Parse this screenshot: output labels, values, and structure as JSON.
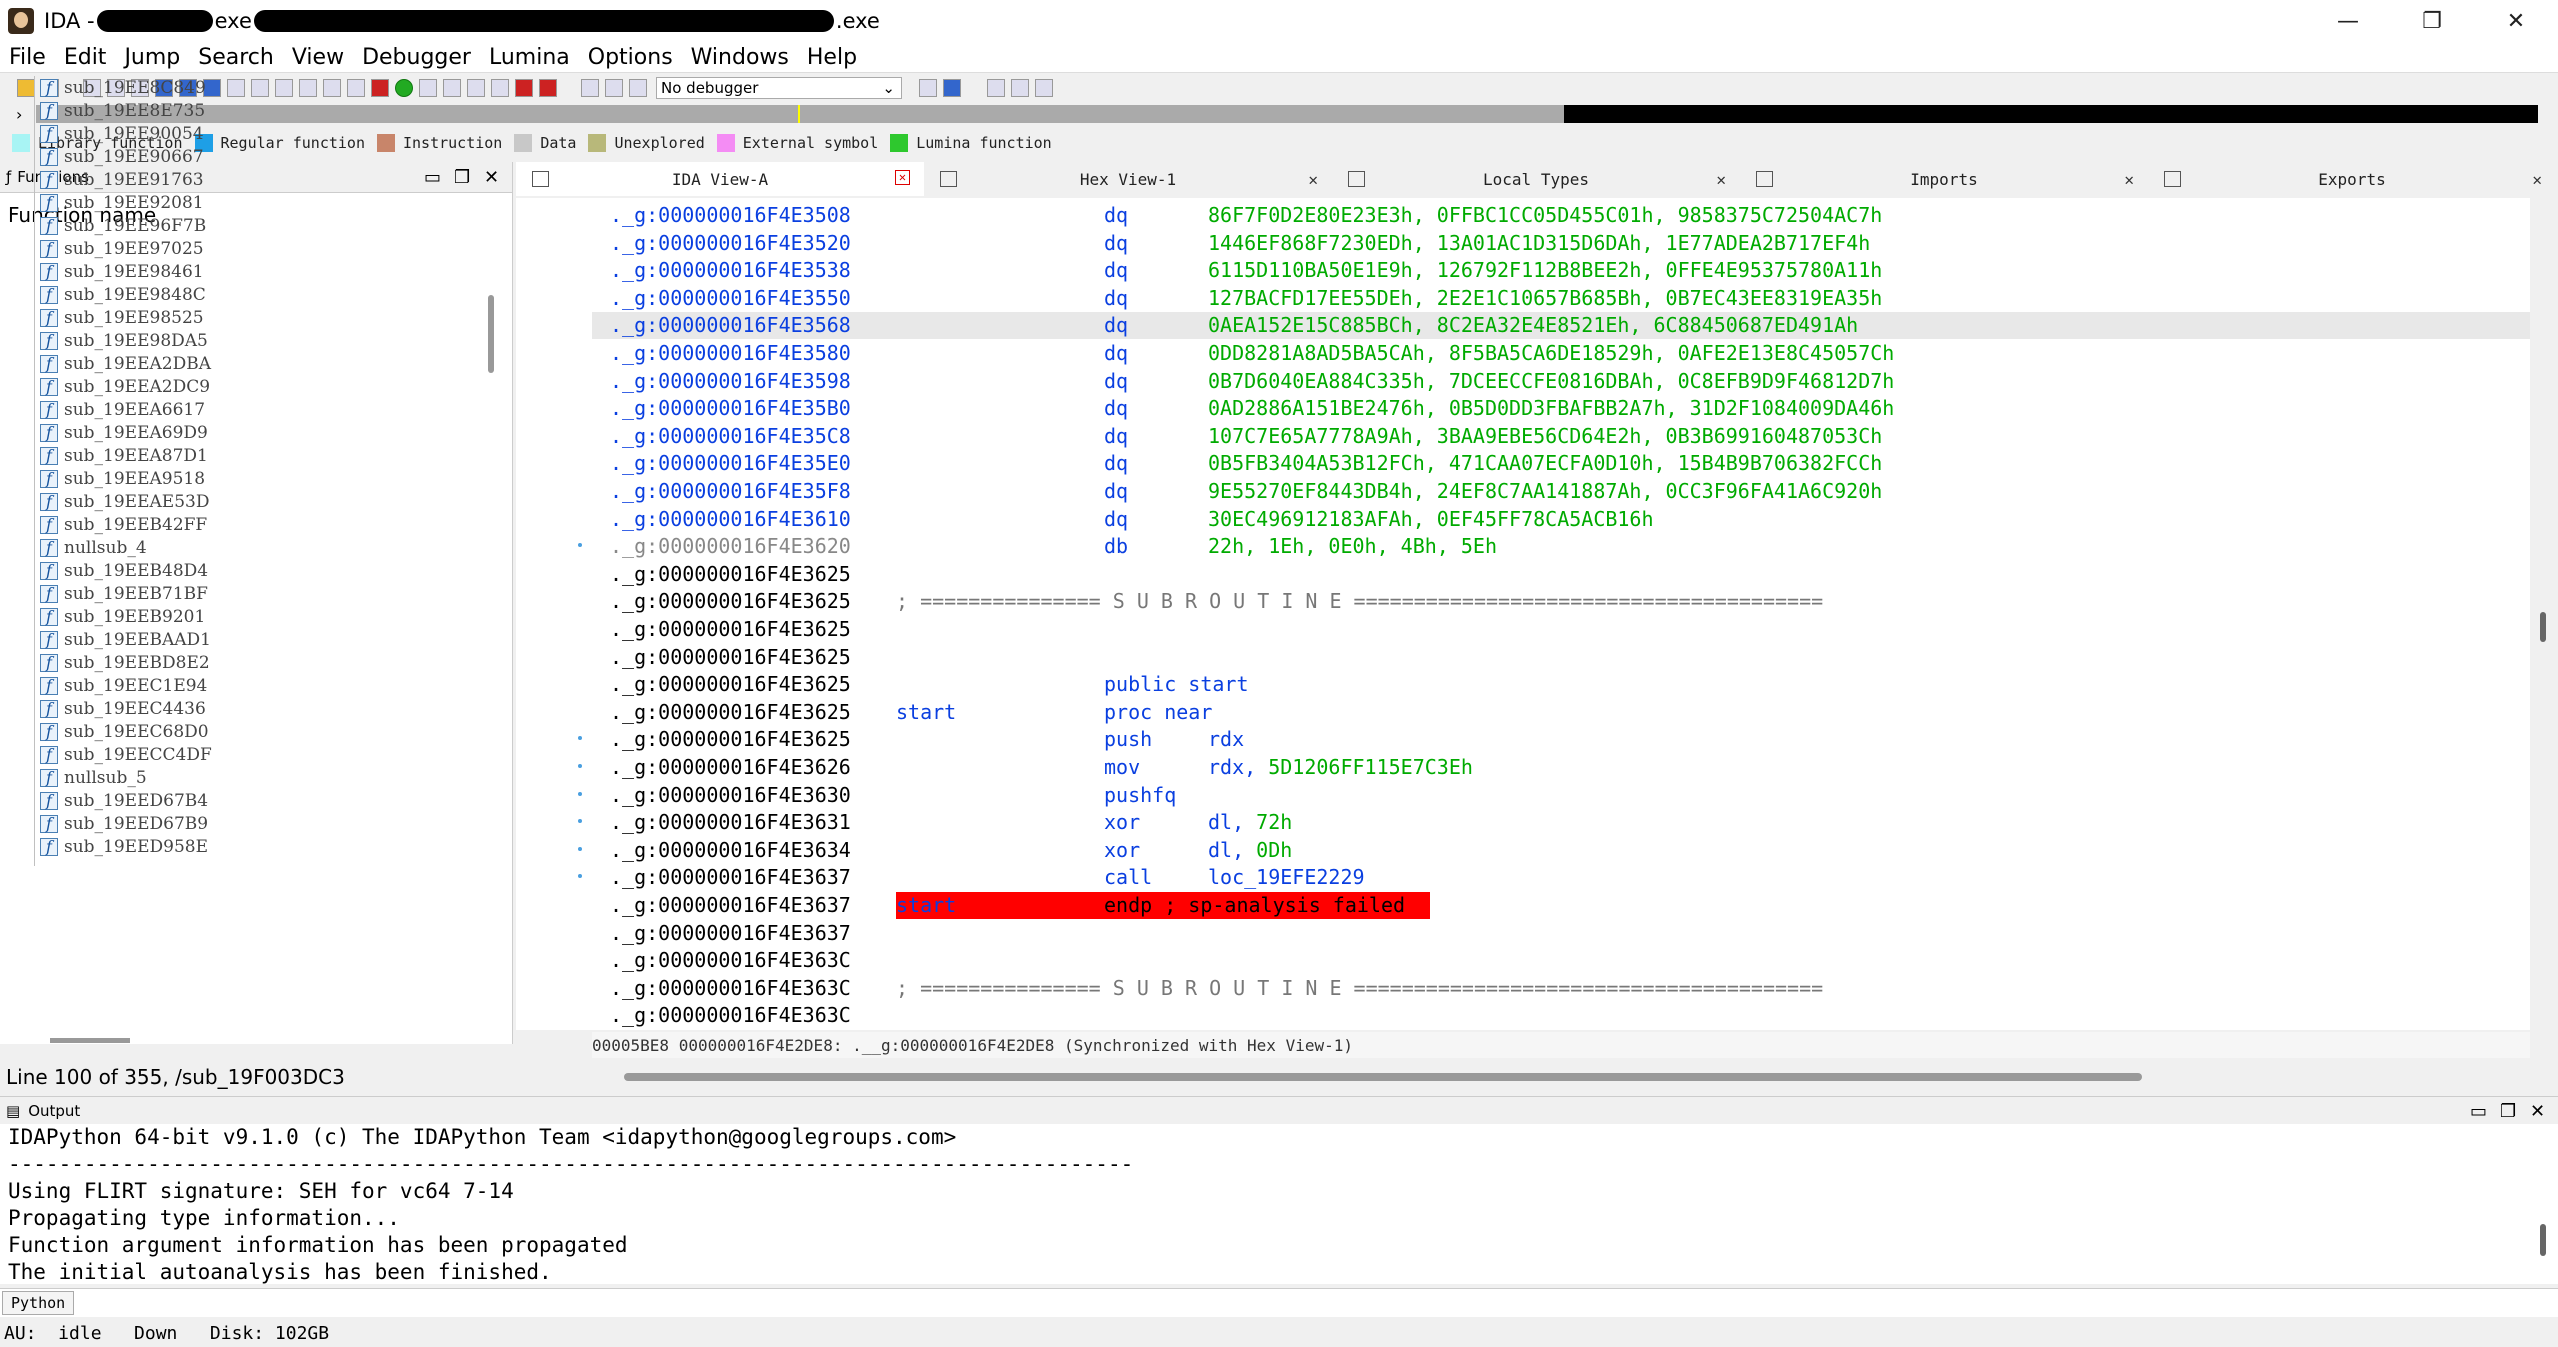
{
  "window": {
    "title_prefix": "IDA -",
    "title_mid": "exe",
    "title_suffix": ".exe",
    "controls": [
      "—",
      "❐",
      "✕"
    ]
  },
  "menu": [
    "File",
    "Edit",
    "Jump",
    "Search",
    "View",
    "Debugger",
    "Lumina",
    "Options",
    "Windows",
    "Help"
  ],
  "toolbar": {
    "debugger_select": "No debugger"
  },
  "legend": [
    {
      "label": "Library function",
      "color": "#a8f4f4"
    },
    {
      "label": "Regular function",
      "color": "#1e9fe6"
    },
    {
      "label": "Instruction",
      "color": "#c8856a"
    },
    {
      "label": "Data",
      "color": "#c8c8c8"
    },
    {
      "label": "Unexplored",
      "color": "#b8b87a"
    },
    {
      "label": "External symbol",
      "color": "#f48cf4"
    },
    {
      "label": "Lumina function",
      "color": "#2ec82e"
    }
  ],
  "functions_pane": {
    "title": "Functions",
    "column_header": "Function name",
    "items": [
      "sub_19EE8C849",
      "sub_19EE8E735",
      "sub_19EE90054",
      "sub_19EE90667",
      "sub_19EE91763",
      "sub_19EE92081",
      "sub_19EE96F7B",
      "sub_19EE97025",
      "sub_19EE98461",
      "sub_19EE9848C",
      "sub_19EE98525",
      "sub_19EE98DA5",
      "sub_19EEA2DBA",
      "sub_19EEA2DC9",
      "sub_19EEA6617",
      "sub_19EEA69D9",
      "sub_19EEA87D1",
      "sub_19EEA9518",
      "sub_19EEAE53D",
      "sub_19EEB42FF",
      "nullsub_4",
      "sub_19EEB48D4",
      "sub_19EEB71BF",
      "sub_19EEB9201",
      "sub_19EEBAAD1",
      "sub_19EEBD8E2",
      "sub_19EEC1E94",
      "sub_19EEC4436",
      "sub_19EEC68D0",
      "sub_19EECC4DF",
      "nullsub_5",
      "sub_19EED67B4",
      "sub_19EED67B9",
      "sub_19EED958E"
    ],
    "status": "Line 100 of 355, /sub_19F003DC3"
  },
  "tabs": [
    {
      "label": "IDA View-A",
      "active": true
    },
    {
      "label": "Hex View-1",
      "active": false
    },
    {
      "label": "Local Types",
      "active": false
    },
    {
      "label": "Imports",
      "active": false
    },
    {
      "label": "Exports",
      "active": false
    }
  ],
  "disasm": [
    {
      "addr": "._g:000000016F4E3508",
      "style": "blue",
      "mnem": "dq",
      "ops": "86F7F0D2E80E23E3h, 0FFBC1CC05D455C01h, 9858375C72504AC7h"
    },
    {
      "addr": "._g:000000016F4E3520",
      "style": "blue",
      "mnem": "dq",
      "ops": "1446EF868F7230EDh, 13A01AC1D315D6DAh, 1E77ADEA2B717EF4h"
    },
    {
      "addr": "._g:000000016F4E3538",
      "style": "blue",
      "mnem": "dq",
      "ops": "6115D110BA50E1E9h, 126792F112B8BEE2h, 0FFE4E95375780A11h"
    },
    {
      "addr": "._g:000000016F4E3550",
      "style": "blue",
      "mnem": "dq",
      "ops": "127BACFD17EE55DEh, 2E2E1C10657B685Bh, 0B7EC43EE8319EA35h"
    },
    {
      "addr": "._g:000000016F4E3568",
      "style": "blue",
      "mnem": "dq",
      "ops": "0AEA152E15C885BCh, 8C2EA32E4E8521Eh, 6C88450687ED491Ah",
      "hl": true
    },
    {
      "addr": "._g:000000016F4E3580",
      "style": "blue",
      "mnem": "dq",
      "ops": "0DD8281A8AD5BA5CAh, 8F5BA5CA6DE18529h, 0AFE2E13E8C45057Ch"
    },
    {
      "addr": "._g:000000016F4E3598",
      "style": "blue",
      "mnem": "dq",
      "ops": "0B7D6040EA884C335h, 7DCEECCFE0816DBAh, 0C8EFB9D9F46812D7h"
    },
    {
      "addr": "._g:000000016F4E35B0",
      "style": "blue",
      "mnem": "dq",
      "ops": "0AD2886A151BE2476h, 0B5D0DD3FBAFBB2A7h, 31D2F1084009DA46h"
    },
    {
      "addr": "._g:000000016F4E35C8",
      "style": "blue",
      "mnem": "dq",
      "ops": "107C7E65A7778A9Ah, 3BAA9EBE56CD64E2h, 0B3B699160487053Ch"
    },
    {
      "addr": "._g:000000016F4E35E0",
      "style": "blue",
      "mnem": "dq",
      "ops": "0B5FB3404A53B12FCh, 471CAA07ECFA0D10h, 15B4B9B706382FCCh"
    },
    {
      "addr": "._g:000000016F4E35F8",
      "style": "blue",
      "mnem": "dq",
      "ops": "9E55270EF8443DB4h, 24EF8C7AA141887Ah, 0CC3F96FA41A6C920h"
    },
    {
      "addr": "._g:000000016F4E3610",
      "style": "blue",
      "mnem": "dq",
      "ops": "30EC496912183AFAh, 0EF45FF78CA5ACB16h"
    },
    {
      "addr": "._g:000000016F4E3620",
      "style": "grey",
      "mnem": "db",
      "ops": "22h, 1Eh, 0E0h, 4Bh, 5Eh"
    },
    {
      "addr": "._g:000000016F4E3625",
      "style": "black"
    },
    {
      "addr": "._g:000000016F4E3625",
      "style": "black",
      "sep": "; =============== S U B R O U T I N E ======================================="
    },
    {
      "addr": "._g:000000016F4E3625",
      "style": "black"
    },
    {
      "addr": "._g:000000016F4E3625",
      "style": "black"
    },
    {
      "addr": "._g:000000016F4E3625",
      "style": "black",
      "mnem": "public start",
      "plain": true
    },
    {
      "addr": "._g:000000016F4E3625",
      "style": "black",
      "label": "start",
      "mnem": "proc near",
      "plain": true
    },
    {
      "addr": "._g:000000016F4E3625",
      "style": "black",
      "mnem": "push",
      "ops": "rdx",
      "plainops": true
    },
    {
      "addr": "._g:000000016F4E3626",
      "style": "black",
      "mnem": "mov",
      "ops": "rdx, 5D1206FF115E7C3Eh",
      "mixed": [
        "rdx, ",
        "5D1206FF115E7C3Eh"
      ]
    },
    {
      "addr": "._g:000000016F4E3630",
      "style": "black",
      "mnem": "pushfq"
    },
    {
      "addr": "._g:000000016F4E3631",
      "style": "black",
      "mnem": "xor",
      "ops": "dl, 72h",
      "mixed": [
        "dl, ",
        "72h"
      ]
    },
    {
      "addr": "._g:000000016F4E3634",
      "style": "black",
      "mnem": "xor",
      "ops": "dl, 0Dh",
      "mixed": [
        "dl, ",
        "0Dh"
      ]
    },
    {
      "addr": "._g:000000016F4E3637",
      "style": "black",
      "mnem": "call",
      "ops": "loc_19EFE2229",
      "plainops": true
    },
    {
      "addr": "._g:000000016F4E3637",
      "style": "black",
      "endp": true,
      "label": "start",
      "endp_text": "endp ; sp-analysis failed"
    },
    {
      "addr": "._g:000000016F4E3637",
      "style": "black"
    },
    {
      "addr": "._g:000000016F4E363C",
      "style": "black"
    },
    {
      "addr": "._g:000000016F4E363C",
      "style": "black",
      "sep": "; =============== S U B R O U T I N E ======================================="
    },
    {
      "addr": "._g:000000016F4E363C",
      "style": "black"
    },
    {
      "addr": "._g:000000016F4E363C",
      "style": "black"
    }
  ],
  "ida_status": "00005BE8 000000016F4E2DE8: .__g:000000016F4E2DE8 (Synchronized with Hex View-1)",
  "output": {
    "title": "Output",
    "lines": [
      "IDAPython 64-bit v9.1.0 (c) The IDAPython Team <idapython@googlegroups.com>",
      "-----------------------------------------------------------------------------------------",
      "Using FLIRT signature: SEH for vc64 7-14",
      "Propagating type information...",
      "Function argument information has been propagated",
      "The initial autoanalysis has been finished."
    ]
  },
  "python_button": "Python",
  "statusbar": "AU:  idle   Down   Disk: 102GB"
}
